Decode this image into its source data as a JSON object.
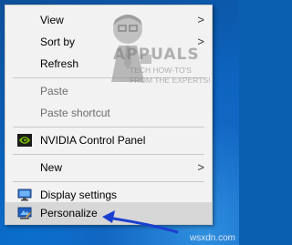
{
  "context_menu": {
    "items": [
      {
        "label": "View",
        "disabled": false,
        "submenu": true
      },
      {
        "label": "Sort by",
        "disabled": false,
        "submenu": true
      },
      {
        "label": "Refresh",
        "disabled": false,
        "submenu": false
      },
      {
        "label": "Paste",
        "disabled": true,
        "submenu": false
      },
      {
        "label": "Paste shortcut",
        "disabled": true,
        "submenu": false
      },
      {
        "label": "NVIDIA Control Panel",
        "disabled": false,
        "submenu": false,
        "icon": "nvidia-icon"
      },
      {
        "label": "New",
        "disabled": false,
        "submenu": true
      },
      {
        "label": "Display settings",
        "disabled": false,
        "submenu": false,
        "icon": "display-icon"
      },
      {
        "label": "Personalize",
        "disabled": false,
        "submenu": false,
        "icon": "personalize-icon",
        "highlighted": true
      }
    ],
    "submenu_glyph": ">"
  },
  "logo": {
    "title": "APPUALS",
    "tagline": "TECH HOW-TO'S FROM THE EXPERTS!"
  },
  "watermark": "wsxdn.com",
  "colors": {
    "menu_bg": "#f2f2f2",
    "highlight": "#d7d7d7",
    "arrow": "#1a3fcf",
    "nvidia_green": "#76b900",
    "desktop_blue": "#0a64bf"
  }
}
